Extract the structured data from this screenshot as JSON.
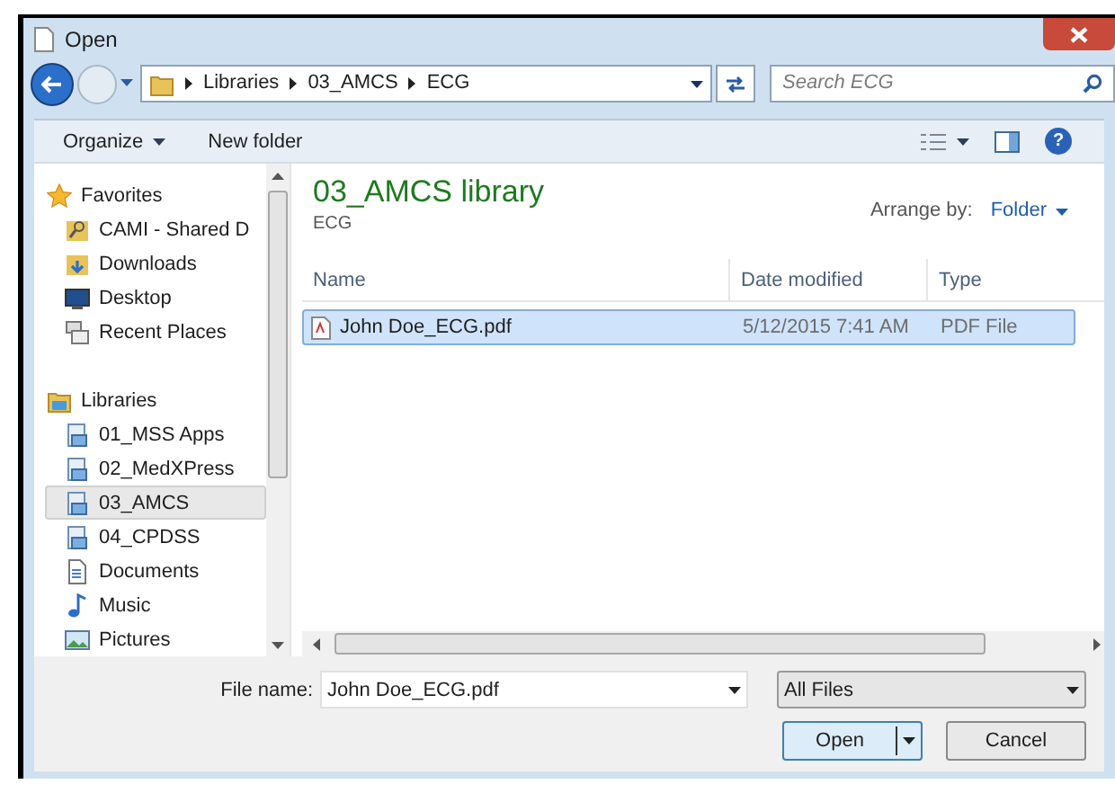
{
  "window": {
    "title": "Open"
  },
  "address": {
    "crumbs": [
      "Libraries",
      "03_AMCS",
      "ECG"
    ],
    "search_placeholder": "Search ECG"
  },
  "toolbar": {
    "organize": "Organize",
    "new_folder": "New folder",
    "help": "?"
  },
  "sidebar": [
    {
      "label": "Favorites",
      "kind": "star",
      "selected": false,
      "children": [
        {
          "label": "CAMI - Shared D",
          "kind": "network",
          "selected": false
        },
        {
          "label": "Downloads",
          "kind": "downloads",
          "selected": false
        },
        {
          "label": "Desktop",
          "kind": "desktop",
          "selected": false
        },
        {
          "label": "Recent Places",
          "kind": "recent",
          "selected": false
        }
      ]
    },
    {
      "label": "Libraries",
      "kind": "libraries",
      "selected": false,
      "children": [
        {
          "label": "01_MSS Apps",
          "kind": "library",
          "selected": false
        },
        {
          "label": "02_MedXPress",
          "kind": "library",
          "selected": false
        },
        {
          "label": "03_AMCS",
          "kind": "library",
          "selected": true
        },
        {
          "label": "04_CPDSS",
          "kind": "library",
          "selected": false
        },
        {
          "label": "Documents",
          "kind": "documents",
          "selected": false
        },
        {
          "label": "Music",
          "kind": "music",
          "selected": false
        },
        {
          "label": "Pictures",
          "kind": "pictures",
          "selected": false
        }
      ]
    }
  ],
  "library": {
    "title": "03_AMCS library",
    "subtitle": "ECG",
    "arrange_label": "Arrange by:",
    "arrange_value": "Folder"
  },
  "table": {
    "columns": [
      "Name",
      "Date modified",
      "Type"
    ],
    "rows": [
      {
        "name": "John Doe_ECG.pdf",
        "date": "5/12/2015 7:41 AM",
        "type": "PDF File",
        "selected": true
      }
    ]
  },
  "footer": {
    "file_name_label": "File name:",
    "file_name": "John Doe_ECG.pdf",
    "filter": "All Files",
    "open": "Open",
    "cancel": "Cancel"
  }
}
